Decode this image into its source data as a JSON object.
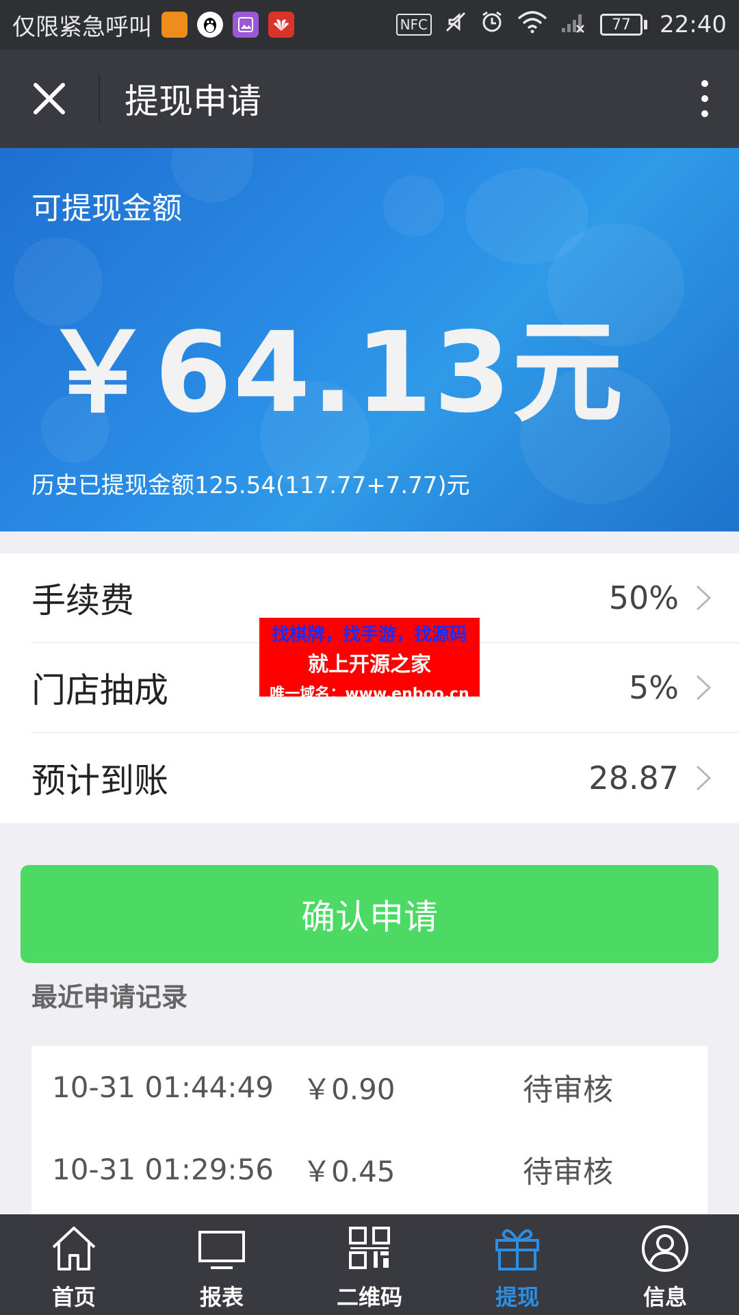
{
  "status_bar": {
    "notice": "仅限紧急呼叫",
    "nfc": "NFC",
    "battery": "77",
    "time": "22:40"
  },
  "header": {
    "title": "提现申请"
  },
  "hero": {
    "label": "可提现金额",
    "amount": "￥64.13元",
    "history": "历史已提现金额125.54(117.77+7.77)元"
  },
  "details": [
    {
      "label": "手续费",
      "value": "50%"
    },
    {
      "label": "门店抽成",
      "value": "5%"
    },
    {
      "label": "预计到账",
      "value": "28.87"
    }
  ],
  "watermark": {
    "line1": "找棋牌，找手游，找源码",
    "line2": "就上开源之家",
    "line3": "唯一域名：www.enboo.cn"
  },
  "confirm_button": "确认申请",
  "records_title": "最近申请记录",
  "records": [
    {
      "time": "10-31 01:44:49",
      "amount": "￥0.90",
      "status": "待审核"
    },
    {
      "time": "10-31 01:29:56",
      "amount": "￥0.45",
      "status": "待审核"
    }
  ],
  "nav": [
    {
      "label": "首页",
      "icon": "home-icon"
    },
    {
      "label": "报表",
      "icon": "monitor-icon"
    },
    {
      "label": "二维码",
      "icon": "qrcode-icon"
    },
    {
      "label": "提现",
      "icon": "gift-icon",
      "active": true
    },
    {
      "label": "信息",
      "icon": "user-icon"
    }
  ],
  "colors": {
    "accent_blue": "#2b8fe6",
    "confirm_green": "#4cd964",
    "header_dark": "#393a3f"
  }
}
